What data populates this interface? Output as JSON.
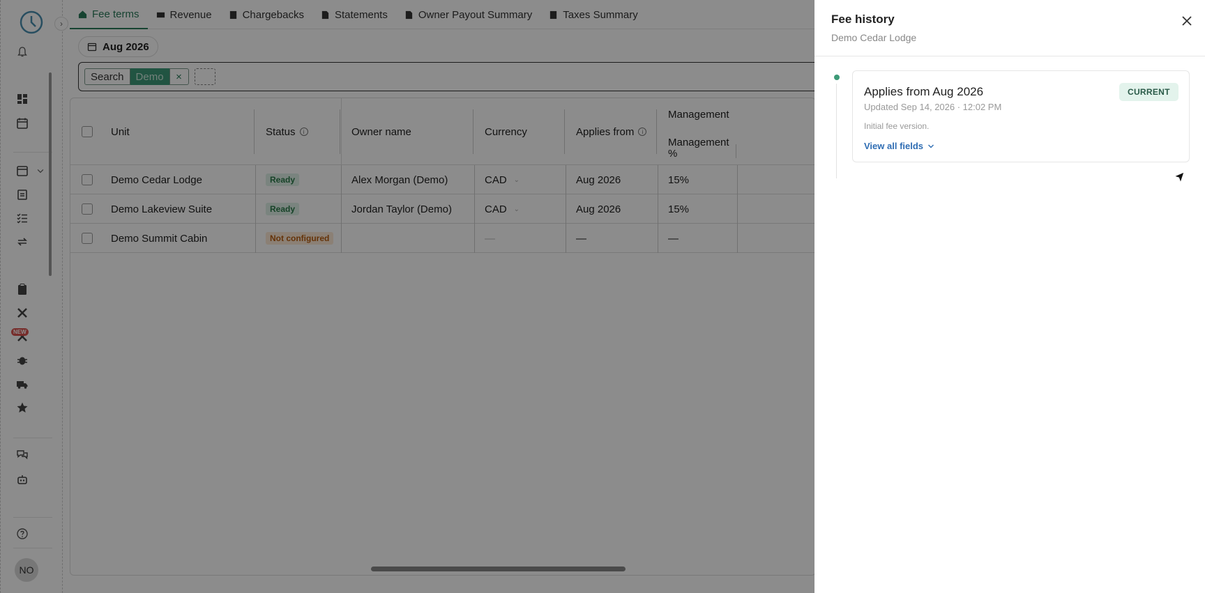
{
  "tabs": [
    {
      "label": "Fee terms",
      "icon": "house-dollar-icon",
      "active": true
    },
    {
      "label": "Revenue",
      "icon": "money-icon"
    },
    {
      "label": "Chargebacks",
      "icon": "document-icon"
    },
    {
      "label": "Statements",
      "icon": "file-dollar-icon"
    },
    {
      "label": "Owner Payout Summary",
      "icon": "file-dollar-icon"
    },
    {
      "label": "Taxes Summary",
      "icon": "document-icon"
    }
  ],
  "date_filter": "Aug 2026",
  "search": {
    "label": "Search",
    "value": "Demo",
    "clear": "×"
  },
  "table": {
    "headers": {
      "unit": "Unit",
      "status": "Status",
      "owner": "Owner name",
      "currency": "Currency",
      "applies_from": "Applies from",
      "management_group": "Management",
      "management_pct": "Management %"
    },
    "rows": [
      {
        "unit": "Demo Cedar Lodge",
        "status": "Ready",
        "owner": "Alex Morgan (Demo)",
        "currency": "CAD",
        "applies_from": "Aug 2026",
        "management_pct": "15%"
      },
      {
        "unit": "Demo Lakeview Suite",
        "status": "Ready",
        "owner": "Jordan Taylor (Demo)",
        "currency": "CAD",
        "applies_from": "Aug 2026",
        "management_pct": "15%"
      },
      {
        "unit": "Demo Summit Cabin",
        "status": "Not configured",
        "owner": "",
        "currency": "—",
        "applies_from": "—",
        "management_pct": "—"
      }
    ]
  },
  "sidebar": {
    "new_badge": "NEW",
    "avatar_initials": "NO"
  },
  "drawer": {
    "title": "Fee history",
    "subtitle": "Demo Cedar Lodge",
    "entry": {
      "title": "Applies from Aug 2026",
      "badge": "CURRENT",
      "updated": "Updated Sep 14, 2026 · 12:02 PM",
      "note": "Initial fee version.",
      "link": "View all fields"
    }
  },
  "colors": {
    "accent": "#2a7a5a",
    "badge_ready_bg": "#dff1e7",
    "badge_nc_bg": "#fde9d6",
    "link": "#2f6db3"
  }
}
